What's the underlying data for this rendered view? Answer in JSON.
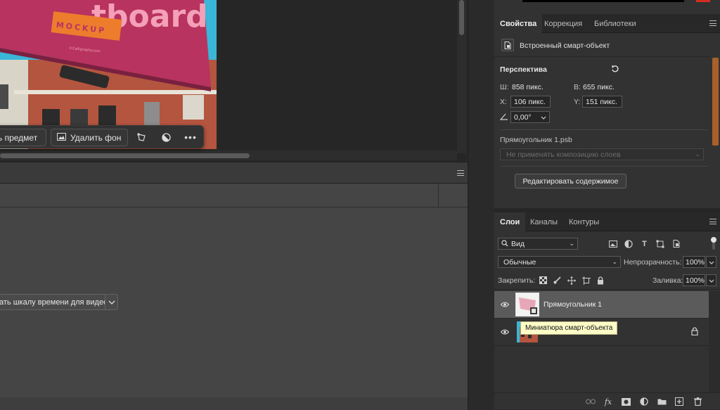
{
  "canvas": {
    "billboard_title": "tboard",
    "billboard_badge": "MOCKUP",
    "billboard_credit": "©Calligraphy.com",
    "taskbar": {
      "select_subject_label": "ь предмет",
      "remove_bg_label": "Удалить фон"
    }
  },
  "timeline": {
    "create_button_label": "ать шкалу времени для видео"
  },
  "properties_panel": {
    "tabs": [
      "Свойства",
      "Коррекция",
      "Библиотеки"
    ],
    "object_type": "Встроенный смарт-объект",
    "section_title": "Перспектива",
    "w_label": "Ш:",
    "w_value": "858 пикс.",
    "h_label": "В:",
    "h_value": "655 пикс.",
    "x_label": "X:",
    "x_value": "106 пикс.",
    "y_label": "Y:",
    "y_value": "151 пикс.",
    "angle_value": "0,00°",
    "file_name": "Прямоугольник 1.psb",
    "layer_comp_placeholder": "Не применять композицию слоев",
    "edit_contents_label": "Редактировать содержимое"
  },
  "layers_panel": {
    "tabs": [
      "Слои",
      "Каналы",
      "Контуры"
    ],
    "filter_label": "Вид",
    "blend_mode": "Обычные",
    "opacity_label": "Непрозрачность:",
    "opacity_value": "100%",
    "lock_label": "Закрепить:",
    "fill_label": "Заливка:",
    "fill_value": "100%",
    "layers": [
      {
        "name": "Прямоугольник 1",
        "selected": true
      },
      {
        "name": "",
        "locked": true
      }
    ],
    "tooltip": "Миниатюра смарт-объекта"
  },
  "colors": {
    "accent_pink": "#b8335f",
    "badge_orange": "#ed7d2d",
    "sky_blue": "#3ab6d7",
    "brick": "#a84b3a"
  }
}
